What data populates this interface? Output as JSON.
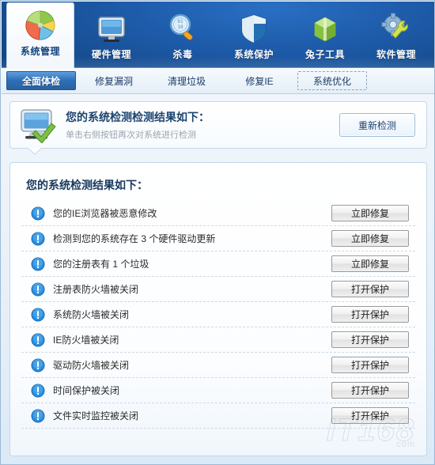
{
  "toolbar": {
    "items": [
      {
        "label": "系统管理",
        "icon": "pie-chart-icon",
        "active": true
      },
      {
        "label": "硬件管理",
        "icon": "monitor-icon",
        "active": false
      },
      {
        "label": "杀毒",
        "icon": "magnifier-icon",
        "active": false
      },
      {
        "label": "系统保护",
        "icon": "shield-icon",
        "active": false
      },
      {
        "label": "兔子工具",
        "icon": "green-box-icon",
        "active": false
      },
      {
        "label": "软件管理",
        "icon": "gear-wrench-icon",
        "active": false
      }
    ]
  },
  "tabs": [
    {
      "label": "全面体检",
      "state": "selected"
    },
    {
      "label": "修复漏洞",
      "state": "normal"
    },
    {
      "label": "清理垃圾",
      "state": "normal"
    },
    {
      "label": "修复IE",
      "state": "normal"
    },
    {
      "label": "系统优化",
      "state": "focused"
    }
  ],
  "banner": {
    "icon": "monitor-check-icon",
    "title": "您的系统检测检测结果如下：",
    "subtitle": "单击右侧按钮再次对系统进行检测",
    "rescan_label": "重新检测"
  },
  "results": {
    "title": "您的系统检测结果如下：",
    "rows": [
      {
        "icon": "warning-icon",
        "label": "您的IE浏览器被恶意修改",
        "action": "立即修复"
      },
      {
        "icon": "warning-icon",
        "label": "检测到您的系统存在 3 个硬件驱动更新",
        "action": "立即修复"
      },
      {
        "icon": "warning-icon",
        "label": "您的注册表有 1 个垃圾",
        "action": "立即修复"
      },
      {
        "icon": "warning-icon",
        "label": "注册表防火墙被关闭",
        "action": "打开保护"
      },
      {
        "icon": "warning-icon",
        "label": "系统防火墙被关闭",
        "action": "打开保护"
      },
      {
        "icon": "warning-icon",
        "label": "IE防火墙被关闭",
        "action": "打开保护"
      },
      {
        "icon": "warning-icon",
        "label": "驱动防火墙被关闭",
        "action": "打开保护"
      },
      {
        "icon": "warning-icon",
        "label": "时间保护被关闭",
        "action": "打开保护"
      },
      {
        "icon": "warning-icon",
        "label": "文件实时监控被关闭",
        "action": "打开保护"
      }
    ]
  },
  "watermark": {
    "main": "IT168",
    "sub": "com"
  },
  "colors": {
    "toolbar_blue": "#15508f",
    "tab_selected": "#2f6fb8",
    "panel_border": "#c3d8ea",
    "warning_blue": "#2b8fe0",
    "title_text": "#17395f"
  }
}
